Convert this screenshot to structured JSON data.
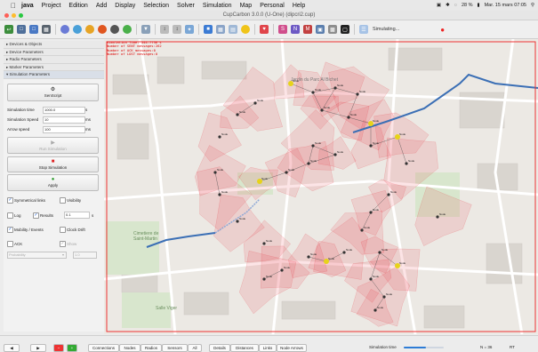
{
  "menubar": {
    "app": "java",
    "items": [
      "Project",
      "Edition",
      "Add",
      "Display",
      "Selection",
      "Solver",
      "Simulation",
      "Map",
      "Personal",
      "Help"
    ],
    "battery": "28 %",
    "clock": "Mar. 15 mars 07:05"
  },
  "window": {
    "title": "CupCarbon 3.0.0 (U-One) (dipcri2.cup)"
  },
  "toolbar": {
    "simulating_label": "Simulating..."
  },
  "sidebar": {
    "sections": [
      "Devices & Objects",
      "Device Parameters",
      "Radio Parameters",
      "Marker Parameters",
      "Simulation Parameters"
    ],
    "senscript_button": "SenScript",
    "simulation_time": {
      "label": "Simulation time",
      "value": "1000.0",
      "unit": "s"
    },
    "simulation_speed": {
      "label": "Simulation Speed",
      "value": "10",
      "unit": "ms"
    },
    "arrow_speed": {
      "label": "Arrow speed",
      "value": "100",
      "unit": "ms"
    },
    "run_button": "Run Simulation",
    "stop_button": "Stop Simulation",
    "apply_button": "Apply",
    "symmetrical_links": "Symmetrical links",
    "visibility": "Visibility",
    "log": "Log",
    "results": "Results",
    "results_value": "0.1",
    "results_unit": "s",
    "mobility": "Mobility / Events",
    "clock_drift": "Clock Drift",
    "ack": "ACK",
    "show": "Show",
    "probability_select": "Probability",
    "probability_value": "1.0"
  },
  "map": {
    "overlay": {
      "line1": "Simulation Time: 544.7736 s",
      "line2": "Number of SENT messages:262",
      "line3": "Number of ACK messages:0",
      "line4": "Number of LOST messages:0"
    },
    "labels": {
      "jardin": "Jardin du Parc Al Bichet",
      "cimetiere1": "Cimetiere de",
      "cimetiere2": "Saint-Martin",
      "salle": "Salle Viger"
    },
    "node_label": "Node"
  },
  "bottombar": {
    "buttons": [
      "Connections",
      "Nodes",
      "Radios",
      "Sensors",
      "All",
      "Details",
      "Distances",
      "Links",
      "Node Arrows"
    ],
    "simulation_time_label": "Simulation time",
    "progress": 0.545,
    "node_count": "N = 36",
    "rt_label": "RT"
  },
  "colors": {
    "accent": "#2e7cd6",
    "range": "#e8303a",
    "route": "#3b6fb5"
  }
}
